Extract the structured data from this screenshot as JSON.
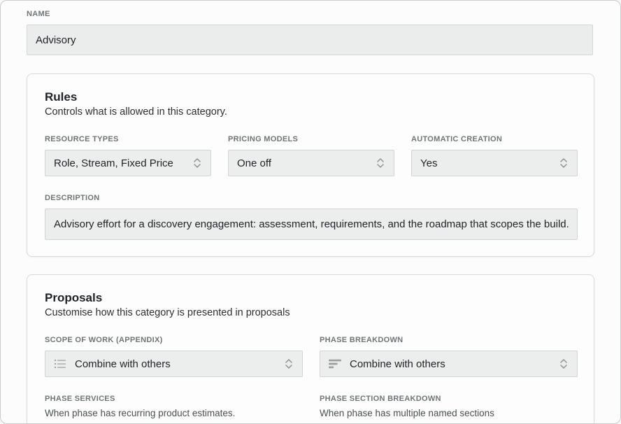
{
  "name": {
    "label": "NAME",
    "value": "Advisory"
  },
  "rules": {
    "title": "Rules",
    "subtitle": "Controls what is allowed in this category.",
    "resource_types": {
      "label": "RESOURCE TYPES",
      "value": "Role, Stream, Fixed Price"
    },
    "pricing_models": {
      "label": "PRICING MODELS",
      "value": "One off"
    },
    "automatic_creation": {
      "label": "AUTOMATIC CREATION",
      "value": "Yes"
    },
    "description": {
      "label": "DESCRIPTION",
      "value": "Advisory effort for a discovery engagement: assessment, requirements, and the roadmap that scopes the build."
    }
  },
  "proposals": {
    "title": "Proposals",
    "subtitle": "Customise how this category is presented in proposals",
    "scope_of_work": {
      "label": "SCOPE OF WORK (APPENDIX)",
      "value": "Combine with others",
      "icon": "list-icon"
    },
    "phase_breakdown": {
      "label": "PHASE BREAKDOWN",
      "value": "Combine with others",
      "icon": "bars-icon"
    },
    "phase_services": {
      "label": "PHASE SERVICES",
      "help": "When phase has recurring product estimates."
    },
    "phase_section_breakdown": {
      "label": "PHASE SECTION BREAKDOWN",
      "help": "When phase has multiple named sections"
    }
  }
}
